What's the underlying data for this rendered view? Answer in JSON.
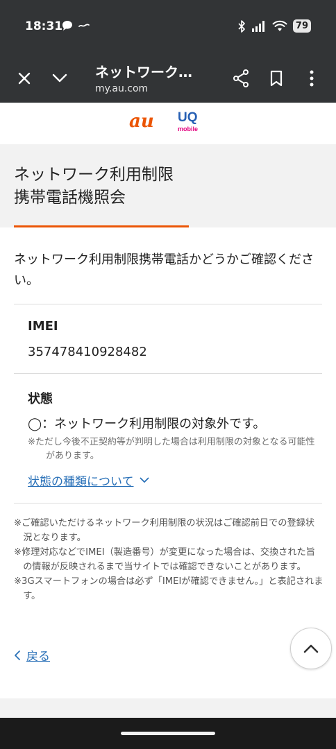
{
  "status_bar": {
    "time": "18:31",
    "battery": "79"
  },
  "browser": {
    "title": "ネットワーク…",
    "url": "my.au.com"
  },
  "logos": {
    "au": "au",
    "uq": "UQ",
    "uq_sub": "mobile"
  },
  "page": {
    "title_line1": "ネットワーク利用制限",
    "title_line2": "携帯電話機照会",
    "intro": "ネットワーク利用制限携帯電話かどうかご確認ください。"
  },
  "imei": {
    "label": "IMEI",
    "value": "357478410928482"
  },
  "status": {
    "label": "状態",
    "value": "◯：ネットワーク利用制限の対象外です。",
    "note": "※ただし今後不正契約等が判明した場合は利用制限の対象となる可能性があります。",
    "link": "状態の種類について"
  },
  "notes": [
    "※ご確認いただけるネットワーク利用制限の状況はご確認前日での登録状況となります。",
    "※修理対応などでIMEI（製造番号）が変更になった場合は、交換された旨の情報が反映されるまで当サイトでは確認できないことがあります。",
    "※3Gスマートフォンの場合は必ず「IMEIが確認できません。」と表記されます。"
  ],
  "back": {
    "label": "戻る"
  },
  "colors": {
    "au_orange": "#eb5505",
    "link_blue": "#2a71b8",
    "uq_blue": "#2760b4",
    "uq_pink": "#e4007f"
  }
}
